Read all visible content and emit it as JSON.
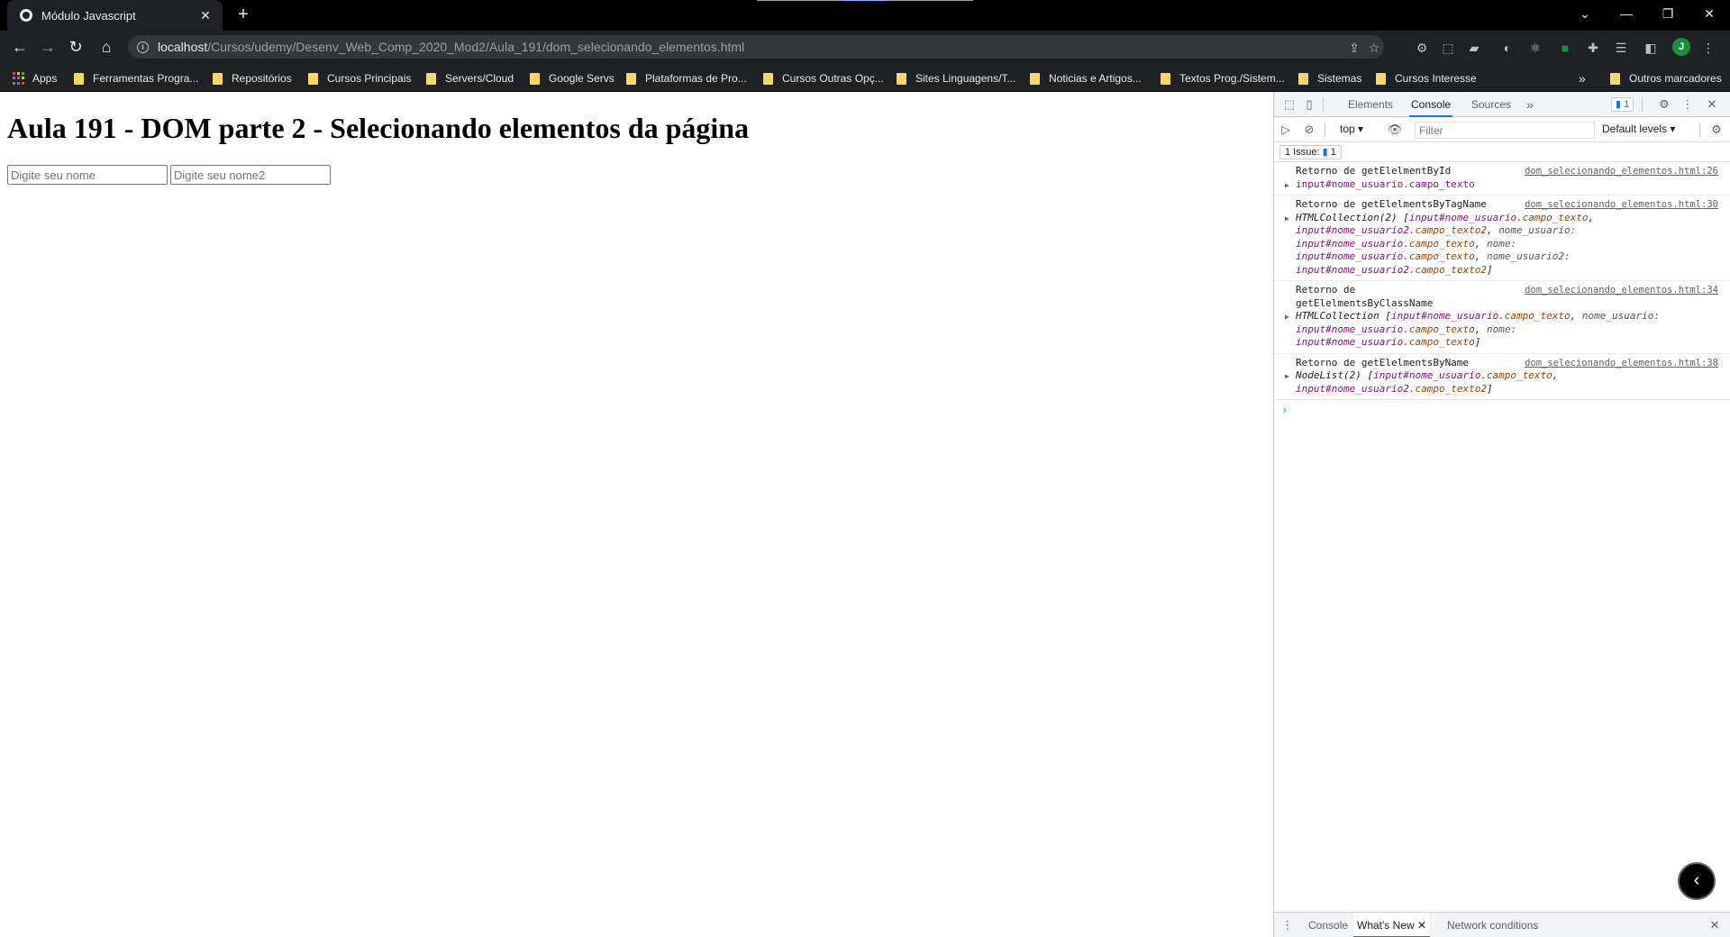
{
  "browser": {
    "tab_title": "Módulo Javascript",
    "url_host": "localhost",
    "url_path": "/Cursos/udemy/Desenv_Web_Comp_2020_Mod2/Aula_191/dom_selecionando_elementos.html",
    "profile_initial": "J",
    "bookmarks": [
      "Apps",
      "Ferramentas Progra...",
      "Repositórios",
      "Cursos Principais",
      "Servers/Cloud",
      "Google Servs",
      "Plataformas de Pro...",
      "Cursos Outras Opç...",
      "Sites Linguagens/T...",
      "Noticias e Artigos...",
      "Textos Prog./Sistem...",
      "Sistemas",
      "Cursos Interesse"
    ],
    "bookmarks_overflow": "»",
    "other_bookmarks": "Outros marcadores"
  },
  "page": {
    "heading": "Aula 191 - DOM parte 2 - Selecionando elementos da página",
    "input1_placeholder": "Digite seu nome",
    "input2_placeholder": "Digite seu nome2"
  },
  "devtools": {
    "tabs": [
      "Elements",
      "Console",
      "Sources"
    ],
    "more_tabs": "»",
    "issues_badge": "1",
    "context": "top",
    "filter_placeholder": "Filter",
    "levels": "Default levels",
    "issue_count_label": "1 Issue:",
    "issue_count": "1",
    "messages": [
      {
        "label": "Retorno de getElelmentById",
        "source": "dom_selecionando_elementos.html:26",
        "obj_tag": "input",
        "obj_id": "#nome_usuario",
        "obj_class": ".campo_texto"
      },
      {
        "label": "Retorno de getElelmentsByTagName",
        "source": "dom_selecionando_elementos.html:30",
        "obj_prefix": "HTMLCollection(2) [",
        "e1_tag": "input",
        "e1_id": "#nome_usuario",
        "e1_class": ".campo_texto",
        "sep": ", ",
        "e2_tag": "input",
        "e2_id": "#nome_usuario2",
        "e2_class": ".campo_texto2",
        "k1": "nome_usuario: ",
        "k2": "nome: ",
        "k3": "nome_usuario2: ",
        "close": "]"
      },
      {
        "label": "Retorno de getElelmentsByClassName",
        "source": "dom_selecionando_elementos.html:34",
        "obj_prefix": "HTMLCollection [",
        "e1_tag": "input",
        "e1_id": "#nome_usuario",
        "e1_class": ".campo_texto",
        "k1": "nome_usuario: ",
        "k2": "nome: ",
        "close": "]"
      },
      {
        "label": "Retorno de getElelmentsByName",
        "source": "dom_selecionando_elementos.html:38",
        "obj_prefix": "NodeList(2) [",
        "e1_tag": "input",
        "e1_id": "#nome_usuario",
        "e1_class": ".campo_texto",
        "e2_tag": "input",
        "e2_id": "#nome_usuario2",
        "e2_class": ".campo_texto2",
        "close": "]"
      }
    ],
    "prompt": "›",
    "drawer_tabs": [
      "Console",
      "What's New",
      "Network conditions"
    ]
  },
  "colors": {
    "accent": "#1a73e8",
    "chrome_dark": "#202124",
    "folder": "#fdd663",
    "profile": "#1e8e3e"
  }
}
